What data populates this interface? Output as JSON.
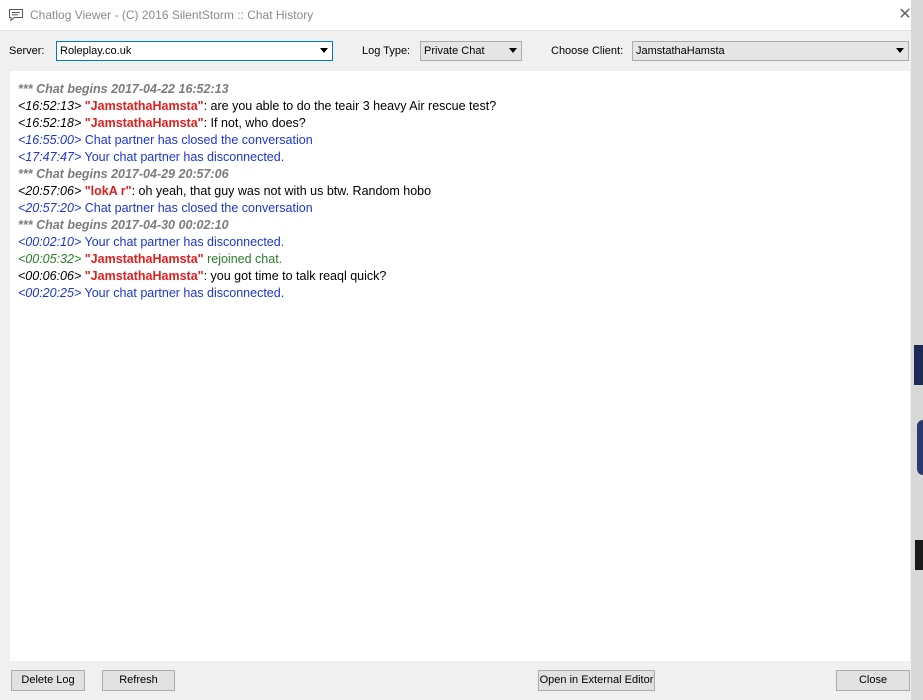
{
  "window": {
    "title": "Chatlog Viewer - (C) 2016 SilentStorm :: Chat History",
    "close_glyph": "✕"
  },
  "toolbar": {
    "server_label": "Server:",
    "server_value": "Roleplay.co.uk",
    "logtype_label": "Log Type:",
    "logtype_value": "Private Chat",
    "client_label": "Choose Client:",
    "client_value": "JamstathaHamsta"
  },
  "log": [
    {
      "type": "header",
      "text": "*** Chat begins 2017-04-22 16:52:13"
    },
    {
      "type": "msg",
      "ts": "<16:52:13>",
      "name": "\"JamstathaHamsta\"",
      "text": ": are you able to do the teair 3 heavy Air rescue test?"
    },
    {
      "type": "msg",
      "ts": "<16:52:18>",
      "name": "\"JamstathaHamsta\"",
      "text": ": If not, who does?"
    },
    {
      "type": "system",
      "ts": "<16:55:00>",
      "text": "Chat partner has closed the conversation"
    },
    {
      "type": "system",
      "ts": "<17:47:47>",
      "text": "Your chat partner has disconnected."
    },
    {
      "type": "header",
      "text": "*** Chat begins 2017-04-29 20:57:06"
    },
    {
      "type": "msg",
      "ts": "<20:57:06>",
      "name": "\"lokA   r\"",
      "text": ": oh yeah, that guy was not with us btw. Random hobo"
    },
    {
      "type": "system",
      "ts": "<20:57:20>",
      "text": "Chat partner has closed the conversation"
    },
    {
      "type": "header",
      "text": "*** Chat begins 2017-04-30 00:02:10"
    },
    {
      "type": "system",
      "ts": "<00:02:10>",
      "text": "Your chat partner has disconnected."
    },
    {
      "type": "rejoin",
      "ts": "<00:05:32>",
      "name": "\"JamstathaHamsta\"",
      "text": " rejoined chat."
    },
    {
      "type": "msg",
      "ts": "<00:06:06>",
      "name": "\"JamstathaHamsta\"",
      "text": ": you got time to talk reaql quick?"
    },
    {
      "type": "system",
      "ts": "<00:20:25>",
      "text": "Your chat partner has disconnected."
    }
  ],
  "buttons": {
    "delete": "Delete Log",
    "refresh": "Refresh",
    "external": "Open in External Editor",
    "close": "Close"
  },
  "colors": {
    "name": "#e41d1d",
    "system": "#1c36d8",
    "rejoin": "#2a7d2a",
    "header": "#7b7b7b"
  },
  "icons": {
    "window": "chat-bubble-icon",
    "dropdown": "chevron-down-icon"
  }
}
